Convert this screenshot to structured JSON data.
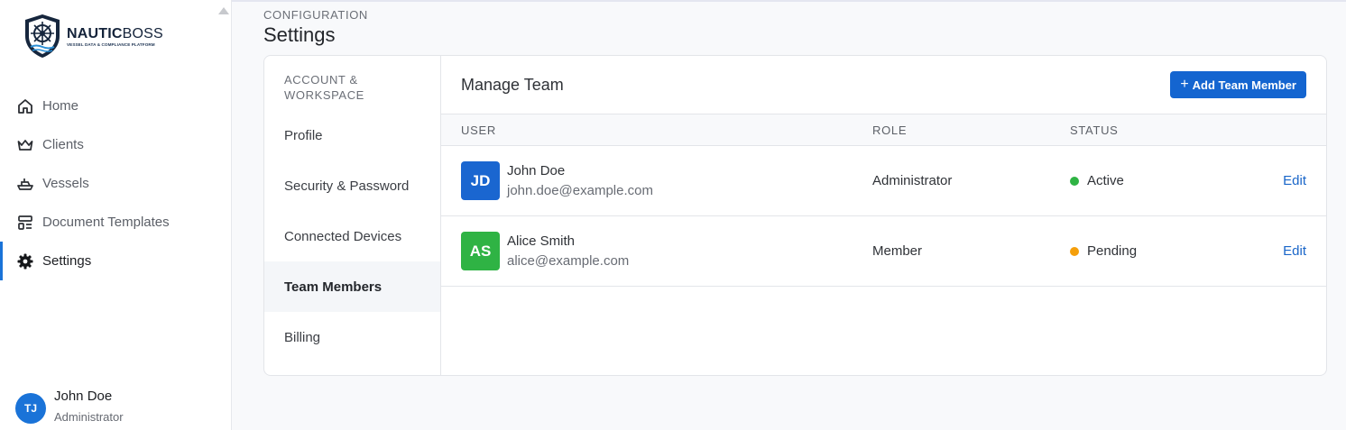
{
  "brand": {
    "name_bold": "NAUTIC",
    "name_regular": "BOSS",
    "tagline": "VESSEL DATA & COMPLIANCE PLATFORM"
  },
  "sidebar": {
    "items": [
      {
        "label": "Home",
        "icon": "home-icon"
      },
      {
        "label": "Clients",
        "icon": "crown-icon"
      },
      {
        "label": "Vessels",
        "icon": "ship-icon"
      },
      {
        "label": "Document Templates",
        "icon": "template-icon"
      },
      {
        "label": "Settings",
        "icon": "gear-icon",
        "active": true
      }
    ],
    "user": {
      "initials": "TJ",
      "name": "John Doe",
      "role": "Administrator"
    }
  },
  "page": {
    "eyebrow": "CONFIGURATION",
    "title": "Settings"
  },
  "settings_menu": {
    "heading": "ACCOUNT & WORKSPACE",
    "items": [
      {
        "label": "Profile"
      },
      {
        "label": "Security & Password"
      },
      {
        "label": "Connected Devices"
      },
      {
        "label": "Team Members",
        "active": true
      },
      {
        "label": "Billing"
      }
    ]
  },
  "team": {
    "title": "Manage Team",
    "add_button": "Add Team Member",
    "add_icon": "+",
    "columns": {
      "user": "USER",
      "role": "ROLE",
      "status": "STATUS"
    },
    "members": [
      {
        "initials": "JD",
        "name": "John Doe",
        "email": "john.doe@example.com",
        "role": "Administrator",
        "status": "Active",
        "avatar_color": "#1a66d0",
        "status_color": "#2fb344",
        "action": "Edit"
      },
      {
        "initials": "AS",
        "name": "Alice Smith",
        "email": "alice@example.com",
        "role": "Member",
        "status": "Pending",
        "avatar_color": "#2fb344",
        "status_color": "#f59f0b",
        "action": "Edit"
      }
    ]
  },
  "colors": {
    "accent": "#1a73d8",
    "button": "#1465d0"
  }
}
